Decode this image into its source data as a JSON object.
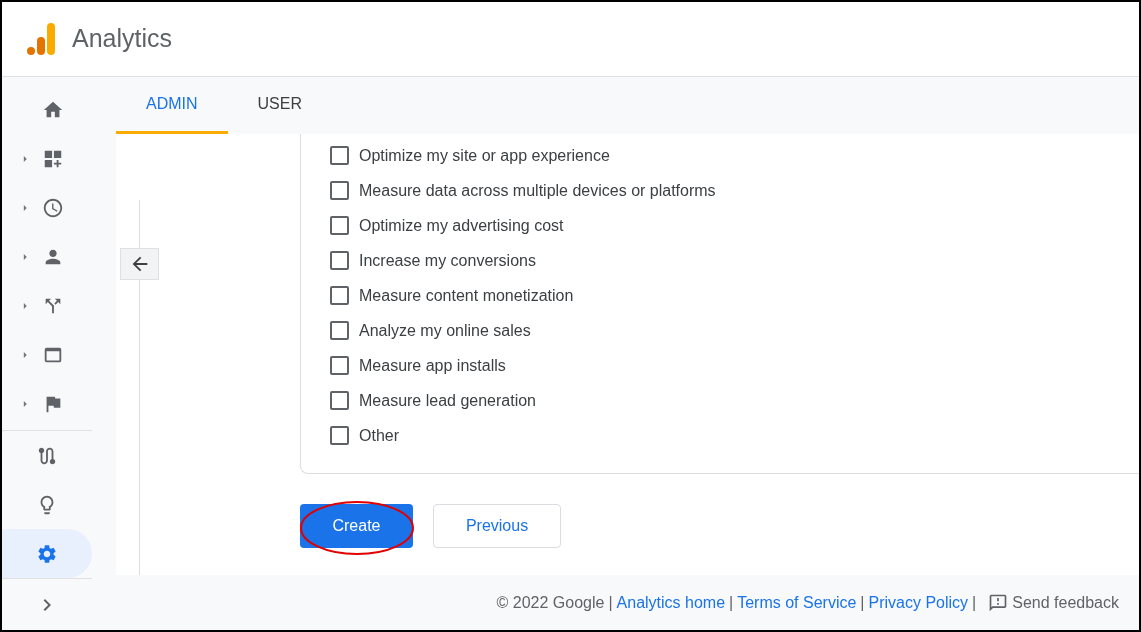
{
  "app": {
    "title": "Analytics"
  },
  "tabs": [
    {
      "label": "ADMIN",
      "selected": true
    },
    {
      "label": "USER",
      "selected": false
    }
  ],
  "sidebar": {
    "top_items": [
      {
        "expandable": false,
        "selected": false
      },
      {
        "expandable": true,
        "selected": false
      },
      {
        "expandable": true,
        "selected": false
      },
      {
        "expandable": true,
        "selected": false
      },
      {
        "expandable": true,
        "selected": false
      },
      {
        "expandable": true,
        "selected": false
      },
      {
        "expandable": true,
        "selected": false
      }
    ],
    "bottom_items": [
      {
        "selected": false
      },
      {
        "selected": false
      },
      {
        "selected": true
      }
    ]
  },
  "objectives": [
    {
      "label": "Optimize my site or app experience",
      "checked": false
    },
    {
      "label": "Measure data across multiple devices or platforms",
      "checked": false
    },
    {
      "label": "Optimize my advertising cost",
      "checked": false
    },
    {
      "label": "Increase my conversions",
      "checked": false
    },
    {
      "label": "Measure content monetization",
      "checked": false
    },
    {
      "label": "Analyze my online sales",
      "checked": false
    },
    {
      "label": "Measure app installs",
      "checked": false
    },
    {
      "label": "Measure lead generation",
      "checked": false
    },
    {
      "label": "Other",
      "checked": false
    }
  ],
  "buttons": [
    {
      "label": "Create",
      "kind": "primary",
      "circled": true
    },
    {
      "label": "Previous",
      "kind": "secondary",
      "circled": false
    }
  ],
  "footer": {
    "items": [
      {
        "kind": "text",
        "text": "© 2022 Google"
      },
      {
        "kind": "separator",
        "text": "|"
      },
      {
        "kind": "link",
        "text": "Analytics home"
      },
      {
        "kind": "separator",
        "text": "|"
      },
      {
        "kind": "link",
        "text": "Terms of Service"
      },
      {
        "kind": "separator",
        "text": "|"
      },
      {
        "kind": "link",
        "text": "Privacy Policy"
      },
      {
        "kind": "separator",
        "text": "|"
      }
    ],
    "feedback": "Send feedback"
  }
}
